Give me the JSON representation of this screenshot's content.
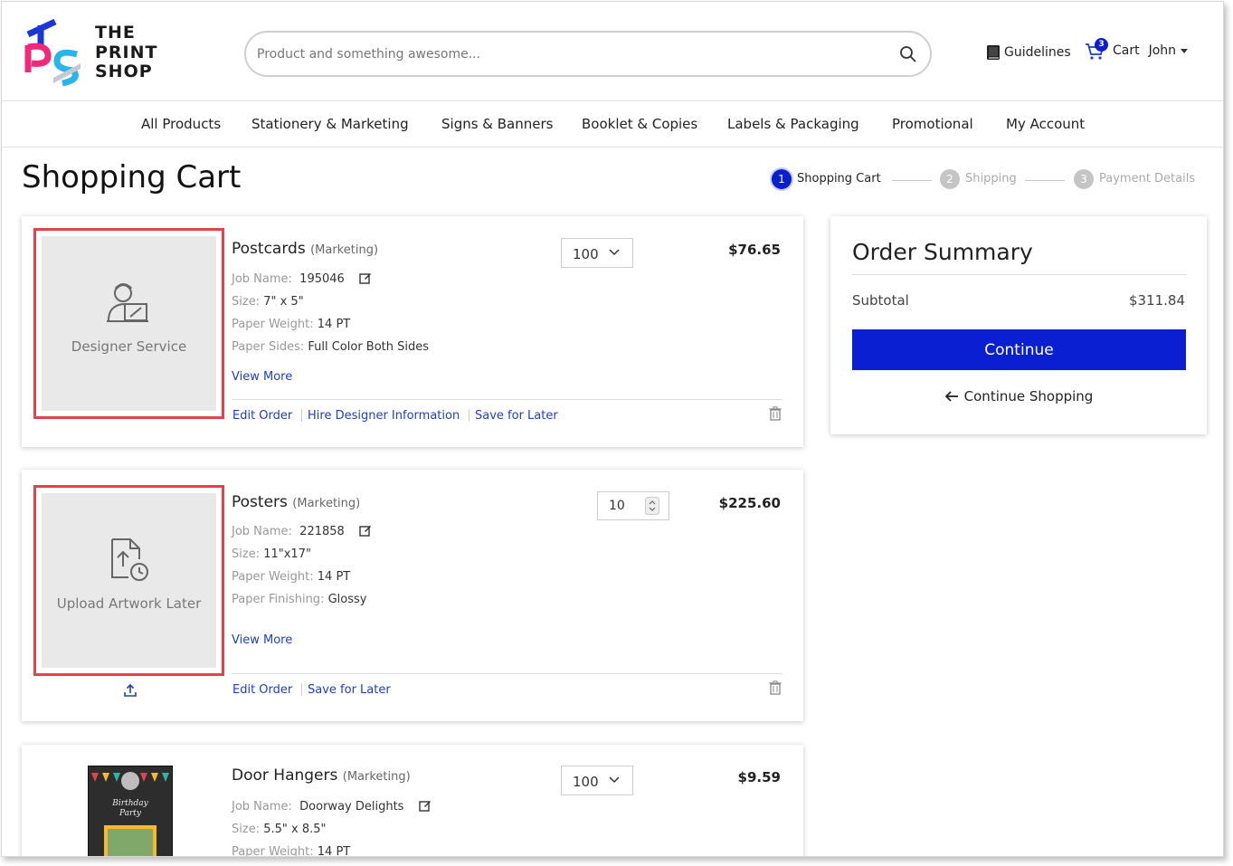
{
  "header": {
    "logo_text": [
      "THE",
      "PRINT",
      "SHOP"
    ],
    "search_placeholder": "Product and something awesome...",
    "guidelines_label": "Guidelines",
    "cart_badge": "3",
    "cart_label": "Cart",
    "user_name": "John"
  },
  "nav": {
    "items": [
      "All Products",
      "Stationery & Marketing",
      "Signs & Banners",
      "Booklet & Copies",
      "Labels & Packaging",
      "Promotional",
      "My Account"
    ]
  },
  "page_title": "Shopping Cart",
  "steps": [
    {
      "num": "1",
      "label": "Shopping Cart"
    },
    {
      "num": "2",
      "label": "Shipping"
    },
    {
      "num": "3",
      "label": "Payment Details"
    }
  ],
  "cart_items": [
    {
      "name": "Postcards",
      "category": "(Marketing)",
      "thumb_label": "Designer Service",
      "qty": "100",
      "price": "$76.65",
      "job_label": "Job Name:",
      "job_name": "195046",
      "details": [
        {
          "k": "Size:",
          "v": "7\" x 5\""
        },
        {
          "k": "Paper Weight:",
          "v": "14 PT"
        },
        {
          "k": "Paper Sides:",
          "v": "Full Color Both Sides"
        }
      ],
      "view_more": "View More",
      "actions": [
        "Edit Order",
        "Hire Designer Information",
        "Save for Later"
      ]
    },
    {
      "name": "Posters",
      "category": "(Marketing)",
      "thumb_label": "Upload Artwork Later",
      "qty": "10",
      "price": "$225.60",
      "job_label": "Job Name:",
      "job_name": "221858",
      "details": [
        {
          "k": "Size:",
          "v": "11\"x17\""
        },
        {
          "k": "Paper Weight:",
          "v": "14 PT"
        },
        {
          "k": "Paper Finishing:",
          "v": "Glossy"
        }
      ],
      "view_more": "View More",
      "actions": [
        "Edit Order",
        "Save for Later"
      ]
    },
    {
      "name": "Door Hangers",
      "category": "(Marketing)",
      "qty": "100",
      "price": "$9.59",
      "job_label": "Job Name:",
      "job_name": "Doorway Delights",
      "thumb_text": "Birthday Party",
      "details": [
        {
          "k": "Size:",
          "v": "5.5\" x 8.5\""
        },
        {
          "k": "Paper Weight:",
          "v": "14 PT"
        }
      ]
    }
  ],
  "summary": {
    "title": "Order Summary",
    "subtotal_label": "Subtotal",
    "subtotal_value": "$311.84",
    "continue_label": "Continue",
    "continue_shopping_label": "Continue Shopping"
  },
  "colors": {
    "accent": "#0a1fd1",
    "highlight_outline": "#e0434c",
    "link": "#1e3fbf"
  }
}
